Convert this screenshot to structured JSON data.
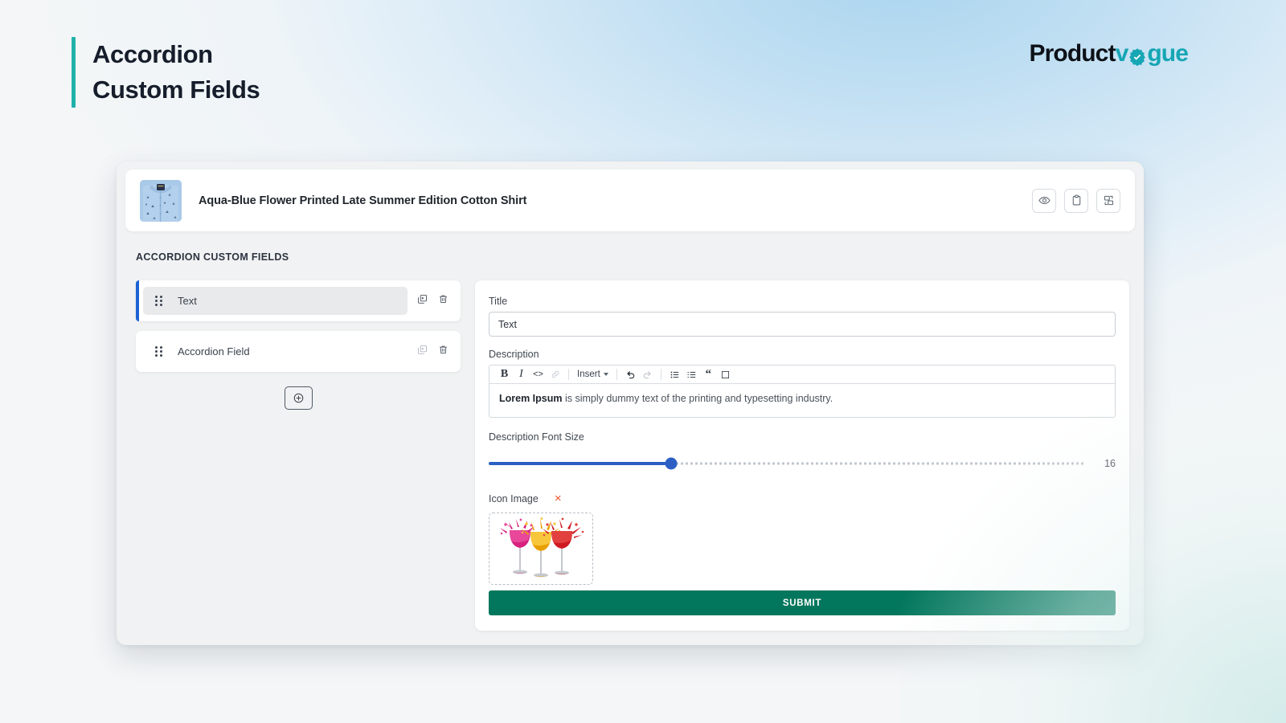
{
  "header": {
    "title_line1": "Accordion",
    "title_line2": "Custom Fields",
    "accent_color": "#20b2aa",
    "brand_part1": "Product",
    "brand_part2": "v",
    "brand_part3": "gue",
    "brand_color": "#17a6b4"
  },
  "product": {
    "name": "Aqua-Blue Flower Printed Late Summer Edition Cotton Shirt",
    "actions": [
      {
        "name": "preview-eye-icon",
        "label": "Preview"
      },
      {
        "name": "clipboard-icon",
        "label": "Clipboard"
      },
      {
        "name": "duplicate-layers-icon",
        "label": "Duplicate"
      }
    ]
  },
  "section": {
    "label": "ACCORDION CUSTOM FIELDS"
  },
  "fields": {
    "items": [
      {
        "label": "Text",
        "active": true
      },
      {
        "label": "Accordion Field",
        "active": false
      }
    ],
    "add_button_label": "+"
  },
  "form": {
    "title_label": "Title",
    "title_value": "Text",
    "title_placeholder": "Title",
    "description_label": "Description",
    "description_bold": "Lorem Ipsum",
    "description_rest": " is simply dummy text of the printing and typesetting industry.",
    "toolbar": {
      "bold": "B",
      "italic": "I",
      "code": "<>",
      "link": "link-icon",
      "insert": "Insert",
      "undo": "undo-icon",
      "redo": "redo-icon",
      "bullet_list": "bullet-list-icon",
      "numbered_list": "numbered-list-icon",
      "blockquote": "“",
      "block": "block-icon"
    },
    "font_size_label": "Description Font Size",
    "font_size_value": "16",
    "font_size_percent": 30.6,
    "icon_image_label": "Icon Image",
    "icon_image_remove": "×",
    "icon_image_alt": "three wine glasses with colorful paint splash",
    "submit_label": "SUBMIT",
    "submit_color": "#03775d"
  }
}
